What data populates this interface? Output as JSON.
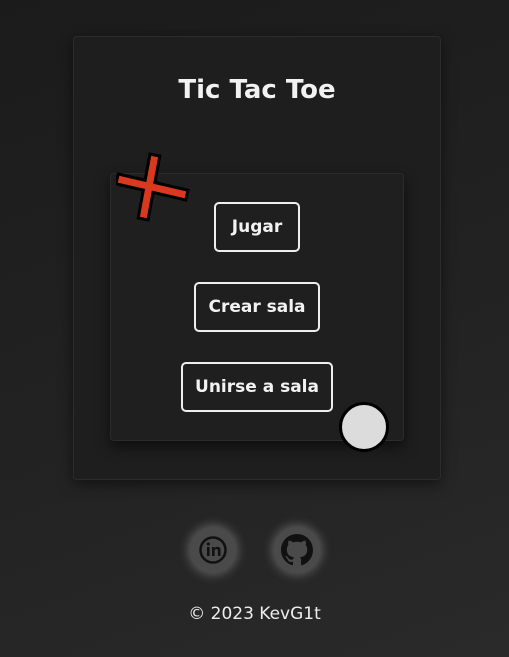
{
  "title": "Tic Tac Toe",
  "buttons": {
    "play": "Jugar",
    "create": "Crear sala",
    "join": "Unirse a sala"
  },
  "footer": "© 2023 KevG1t",
  "colors": {
    "cross": "#d9391f",
    "circle": "#dcdcdc"
  },
  "social": [
    "linkedin-icon",
    "github-icon"
  ]
}
